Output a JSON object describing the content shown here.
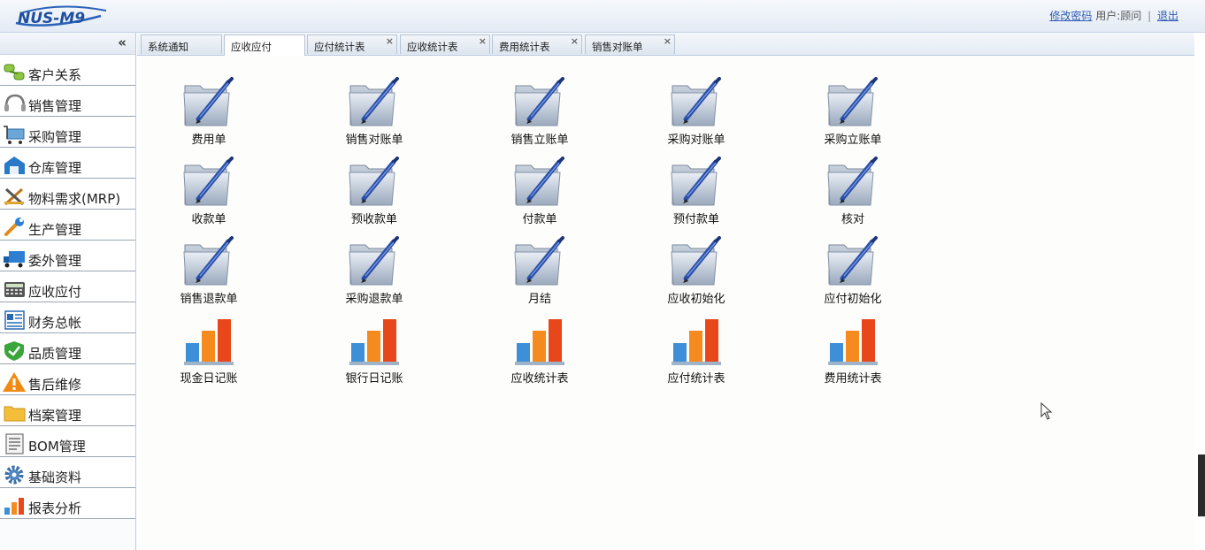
{
  "header": {
    "logo_text": "NUS-M9",
    "change_password": "修改密码",
    "user_label": "用户:顾问",
    "separator": "|",
    "logout": "退出"
  },
  "sidebar": {
    "collapse_glyph": "«",
    "items": [
      {
        "label": "客户关系",
        "icon": "customer-relations-icon"
      },
      {
        "label": "销售管理",
        "icon": "headset-icon"
      },
      {
        "label": "采购管理",
        "icon": "cart-icon"
      },
      {
        "label": "仓库管理",
        "icon": "warehouse-icon"
      },
      {
        "label": "物料需求(MRP)",
        "icon": "tools-icon"
      },
      {
        "label": "生产管理",
        "icon": "wrench-icon"
      },
      {
        "label": "委外管理",
        "icon": "truck-icon"
      },
      {
        "label": "应收应付",
        "icon": "calculator-icon"
      },
      {
        "label": "财务总帐",
        "icon": "ledger-icon"
      },
      {
        "label": "品质管理",
        "icon": "shield-check-icon"
      },
      {
        "label": "售后维修",
        "icon": "warning-icon"
      },
      {
        "label": "档案管理",
        "icon": "folder-icon"
      },
      {
        "label": "BOM管理",
        "icon": "document-icon"
      },
      {
        "label": "基础资料",
        "icon": "gear-icon"
      },
      {
        "label": "报表分析",
        "icon": "bar-chart-icon"
      }
    ]
  },
  "tabs": [
    {
      "label": "系统通知",
      "closable": false
    },
    {
      "label": "应收应付",
      "closable": false
    },
    {
      "label": "应付统计表",
      "closable": true
    },
    {
      "label": "应收统计表",
      "closable": true
    },
    {
      "label": "费用统计表",
      "closable": true
    },
    {
      "label": "销售对账单",
      "closable": true
    }
  ],
  "tab_close_glyph": "×",
  "active_tab": "应收应付",
  "modules": [
    {
      "label": "费用单",
      "icon": "folder-pen-icon"
    },
    {
      "label": "销售对账单",
      "icon": "folder-pen-icon"
    },
    {
      "label": "销售立账单",
      "icon": "folder-pen-icon"
    },
    {
      "label": "采购对账单",
      "icon": "folder-pen-icon"
    },
    {
      "label": "采购立账单",
      "icon": "folder-pen-icon"
    },
    {
      "label": "收款单",
      "icon": "folder-pen-icon"
    },
    {
      "label": "预收款单",
      "icon": "folder-pen-icon"
    },
    {
      "label": "付款单",
      "icon": "folder-pen-icon"
    },
    {
      "label": "预付款单",
      "icon": "folder-pen-icon"
    },
    {
      "label": "核对",
      "icon": "folder-pen-icon"
    },
    {
      "label": "销售退款单",
      "icon": "folder-pen-icon"
    },
    {
      "label": "采购退款单",
      "icon": "folder-pen-icon"
    },
    {
      "label": "月结",
      "icon": "folder-pen-icon"
    },
    {
      "label": "应收初始化",
      "icon": "folder-pen-icon"
    },
    {
      "label": "应付初始化",
      "icon": "folder-pen-icon"
    },
    {
      "label": "现金日记账",
      "icon": "bar-chart-icon"
    },
    {
      "label": "银行日记账",
      "icon": "bar-chart-icon"
    },
    {
      "label": "应收统计表",
      "icon": "bar-chart-icon"
    },
    {
      "label": "应付统计表",
      "icon": "bar-chart-icon"
    },
    {
      "label": "费用统计表",
      "icon": "bar-chart-icon"
    }
  ],
  "colors": {
    "accent_link": "#2d5bb0",
    "bar_orange": "#f58a1f",
    "bar_red": "#e8471c",
    "bar_blue": "#3f8fd8"
  }
}
